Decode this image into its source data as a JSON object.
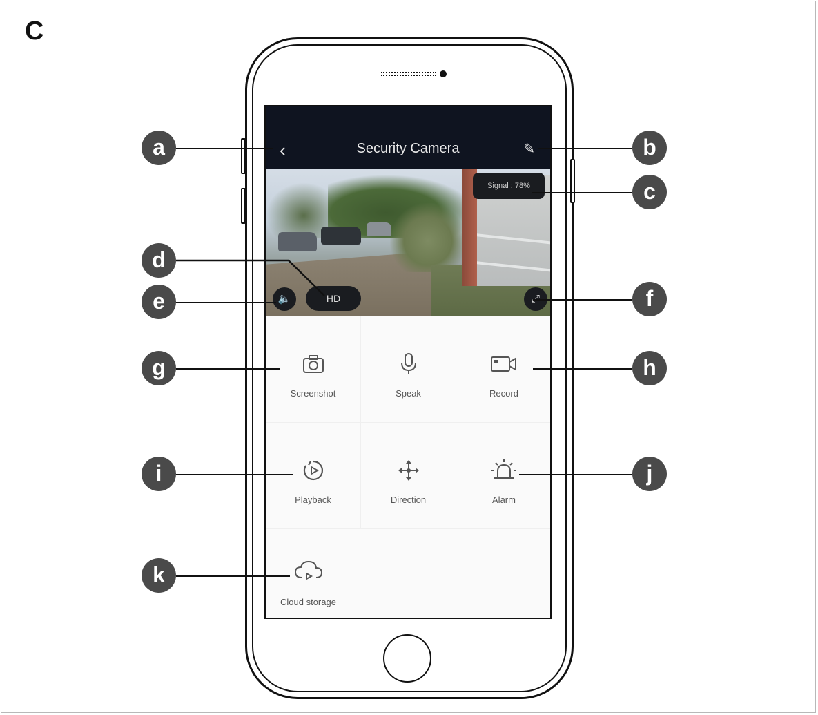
{
  "figure_letter": "C",
  "app": {
    "title": "Security Camera",
    "signal_text": "Signal : 78%",
    "quality_label": "HD"
  },
  "controls": [
    {
      "label": "Screenshot",
      "icon": "camera-icon"
    },
    {
      "label": "Speak",
      "icon": "microphone-icon"
    },
    {
      "label": "Record",
      "icon": "video-record-icon"
    },
    {
      "label": "Playback",
      "icon": "playback-icon"
    },
    {
      "label": "Direction",
      "icon": "direction-arrows-icon"
    },
    {
      "label": "Alarm",
      "icon": "alarm-siren-icon"
    },
    {
      "label": "Cloud storage",
      "icon": "cloud-storage-icon"
    }
  ],
  "callouts": [
    "a",
    "b",
    "c",
    "d",
    "e",
    "f",
    "g",
    "h",
    "i",
    "j",
    "k"
  ]
}
